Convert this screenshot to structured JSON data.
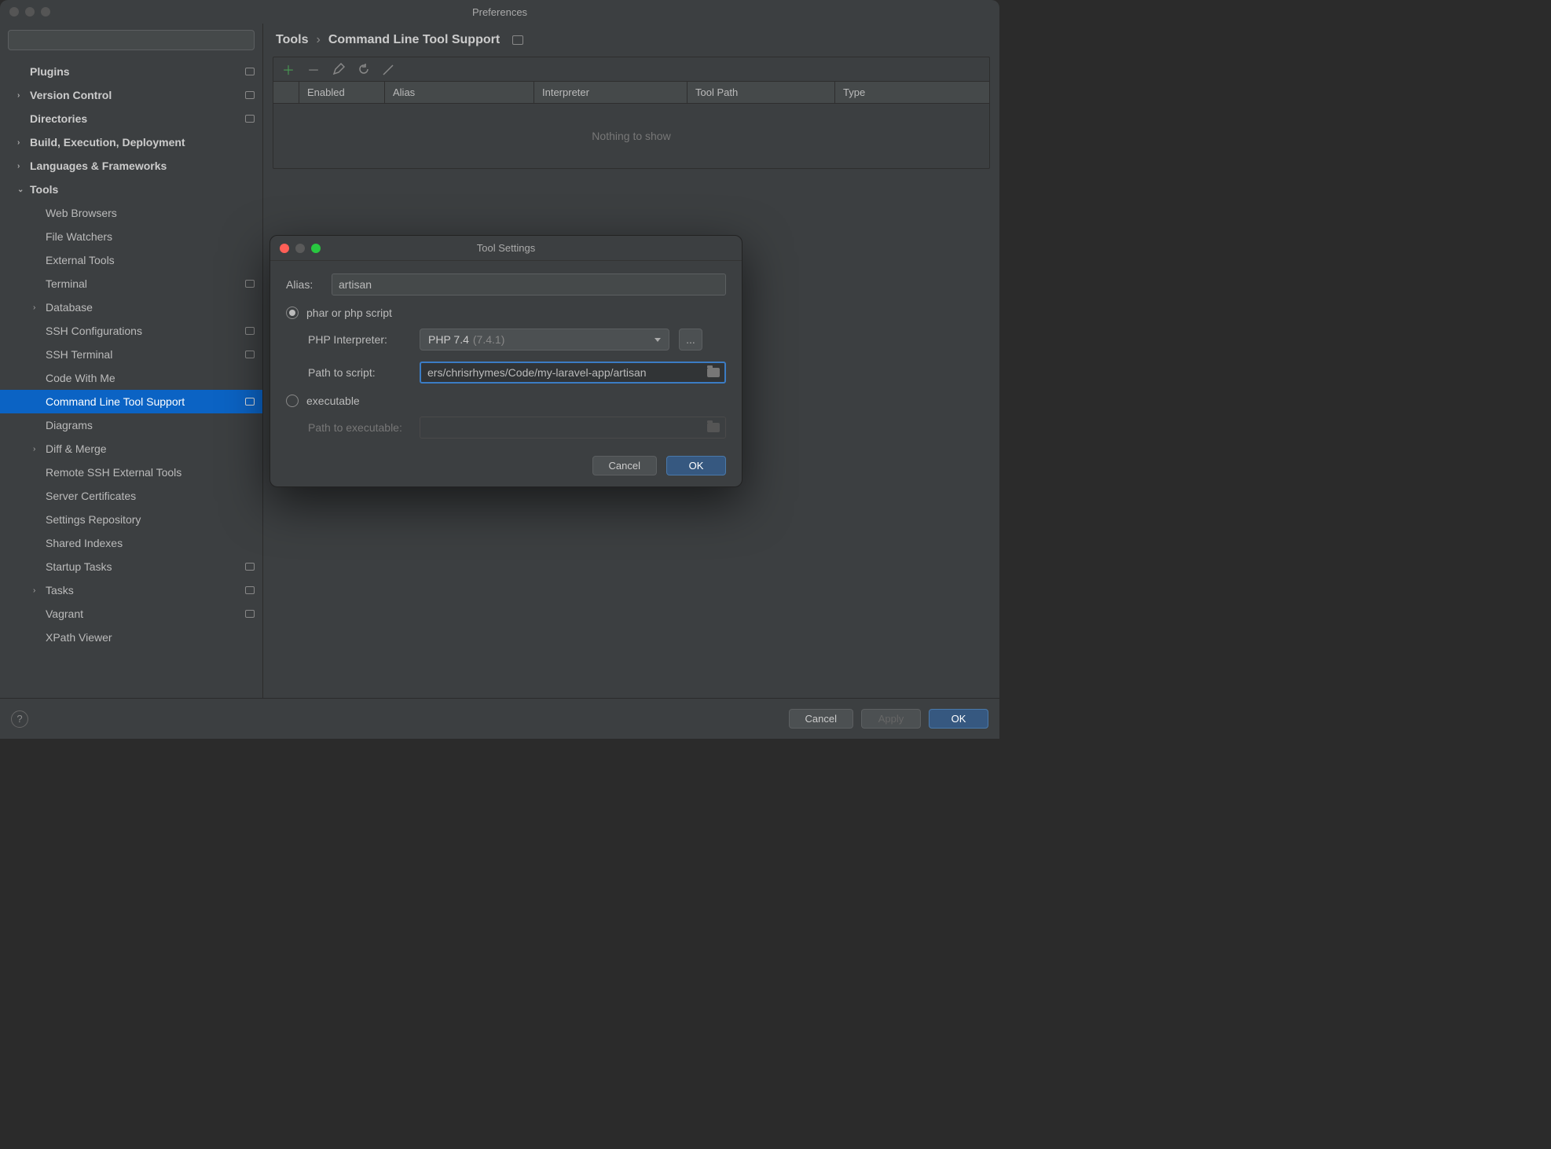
{
  "window": {
    "title": "Preferences"
  },
  "search": {
    "placeholder": ""
  },
  "sidebar": {
    "items": [
      {
        "label": "Plugins",
        "depth": 1,
        "chevron": "",
        "badge": true
      },
      {
        "label": "Version Control",
        "depth": 1,
        "chevron": "›",
        "badge": true
      },
      {
        "label": "Directories",
        "depth": 1,
        "chevron": "",
        "badge": true
      },
      {
        "label": "Build, Execution, Deployment",
        "depth": 1,
        "chevron": "›",
        "badge": false
      },
      {
        "label": "Languages & Frameworks",
        "depth": 1,
        "chevron": "›",
        "badge": false
      },
      {
        "label": "Tools",
        "depth": 1,
        "chevron": "⌄",
        "badge": false
      },
      {
        "label": "Web Browsers",
        "depth": 2,
        "chevron": "",
        "badge": false
      },
      {
        "label": "File Watchers",
        "depth": 2,
        "chevron": "",
        "badge": false
      },
      {
        "label": "External Tools",
        "depth": 2,
        "chevron": "",
        "badge": false
      },
      {
        "label": "Terminal",
        "depth": 2,
        "chevron": "",
        "badge": true
      },
      {
        "label": "Database",
        "depth": 2,
        "chevron": "›",
        "badge": false
      },
      {
        "label": "SSH Configurations",
        "depth": 2,
        "chevron": "",
        "badge": true
      },
      {
        "label": "SSH Terminal",
        "depth": 2,
        "chevron": "",
        "badge": true
      },
      {
        "label": "Code With Me",
        "depth": 2,
        "chevron": "",
        "badge": false
      },
      {
        "label": "Command Line Tool Support",
        "depth": 2,
        "chevron": "",
        "badge": true,
        "selected": true
      },
      {
        "label": "Diagrams",
        "depth": 2,
        "chevron": "",
        "badge": false
      },
      {
        "label": "Diff & Merge",
        "depth": 2,
        "chevron": "›",
        "badge": false
      },
      {
        "label": "Remote SSH External Tools",
        "depth": 2,
        "chevron": "",
        "badge": false
      },
      {
        "label": "Server Certificates",
        "depth": 2,
        "chevron": "",
        "badge": false
      },
      {
        "label": "Settings Repository",
        "depth": 2,
        "chevron": "",
        "badge": false
      },
      {
        "label": "Shared Indexes",
        "depth": 2,
        "chevron": "",
        "badge": false
      },
      {
        "label": "Startup Tasks",
        "depth": 2,
        "chevron": "",
        "badge": true
      },
      {
        "label": "Tasks",
        "depth": 2,
        "chevron": "›",
        "badge": true
      },
      {
        "label": "Vagrant",
        "depth": 2,
        "chevron": "",
        "badge": true
      },
      {
        "label": "XPath Viewer",
        "depth": 2,
        "chevron": "",
        "badge": false
      }
    ]
  },
  "breadcrumb": {
    "root": "Tools",
    "current": "Command Line Tool Support"
  },
  "table": {
    "headers": {
      "enabled": "Enabled",
      "alias": "Alias",
      "interpreter": "Interpreter",
      "tool_path": "Tool Path",
      "type": "Type"
    },
    "empty": "Nothing to show"
  },
  "footer": {
    "cancel": "Cancel",
    "apply": "Apply",
    "ok": "OK"
  },
  "modal": {
    "title": "Tool Settings",
    "alias_label": "Alias:",
    "alias_value": "artisan",
    "radio_phar": "phar or php script",
    "interpreter_label": "PHP Interpreter:",
    "interpreter_value": "PHP 7.4",
    "interpreter_version": "(7.4.1)",
    "interpreter_more": "...",
    "script_label": "Path to script:",
    "script_value": "ers/chrisrhymes/Code/my-laravel-app/artisan",
    "radio_exec": "executable",
    "exec_label": "Path to executable:",
    "exec_value": "",
    "cancel": "Cancel",
    "ok": "OK"
  }
}
